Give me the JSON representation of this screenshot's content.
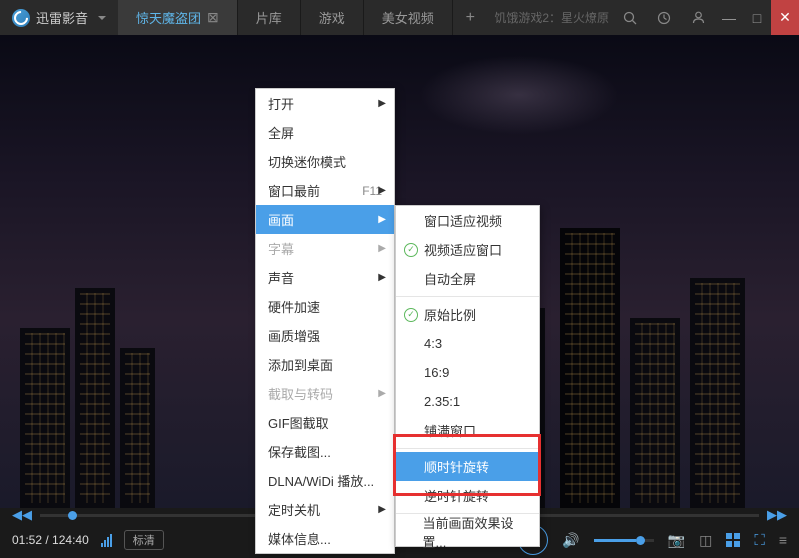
{
  "app_name": "迅雷影音",
  "tabs": [
    {
      "label": "惊天魔盗团",
      "active": true,
      "closable": true
    },
    {
      "label": "片库"
    },
    {
      "label": "游戏"
    },
    {
      "label": "美女视频"
    }
  ],
  "search_placeholder": "饥饿游戏2：星火燎原",
  "context_menu": {
    "open": "打开",
    "fullscreen": "全屏",
    "mini_mode": "切换迷你模式",
    "always_top": "窗口最前",
    "always_top_key": "F11",
    "picture": "画面",
    "subtitle": "字幕",
    "sound": "声音",
    "hw_accel": "硬件加速",
    "enhance": "画质增强",
    "add_desktop": "添加到桌面",
    "capture_encode": "截取与转码",
    "gif_capture": "GIF图截取",
    "save_capture": "保存截图...",
    "dlna": "DLNA/WiDi 播放...",
    "timer_off": "定时关机",
    "media_info": "媒体信息..."
  },
  "submenu": {
    "fit_window": "窗口适应视频",
    "fit_video": "视频适应窗口",
    "auto_full": "自动全屏",
    "original_ratio": "原始比例",
    "r43": "4:3",
    "r169": "16:9",
    "r235": "2.35:1",
    "fill": "铺满窗口",
    "rotate_cw": "顺时针旋转",
    "rotate_ccw": "逆时针旋转",
    "effects": "当前画面效果设置..."
  },
  "playback": {
    "current": "01:52",
    "total": "124:40",
    "quality": "标清"
  }
}
